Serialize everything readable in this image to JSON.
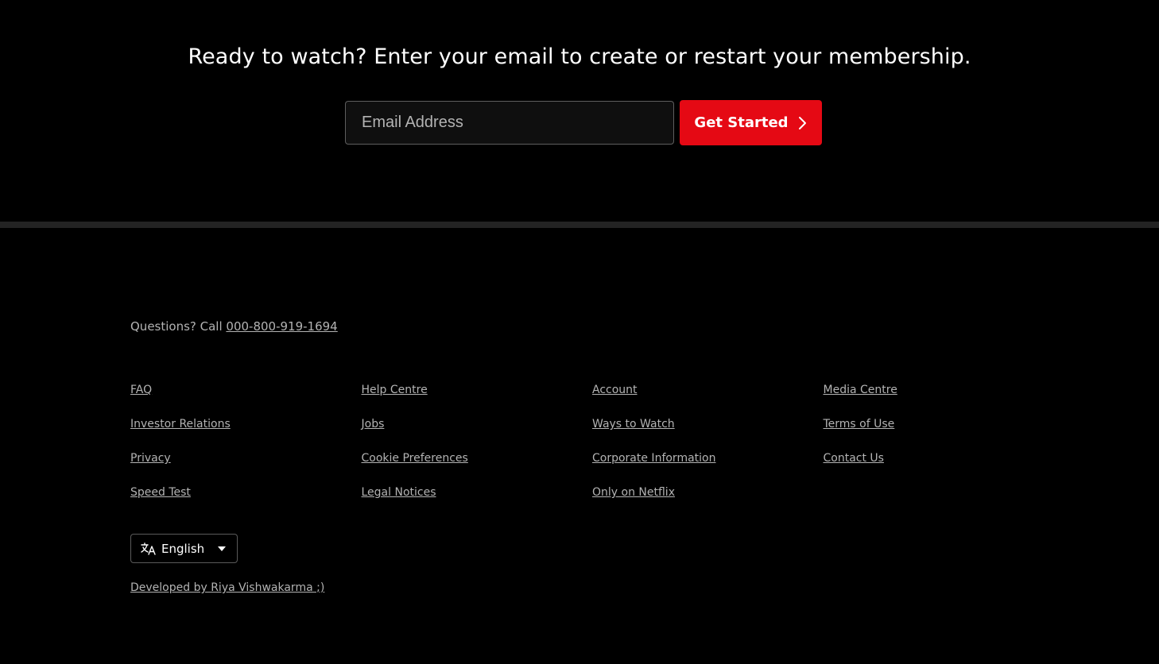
{
  "cta": {
    "heading": "Ready to watch? Enter your email to create or restart your membership.",
    "email_placeholder": "Email Address",
    "button_label": "Get Started"
  },
  "footer": {
    "questions_prefix": "Questions? Call ",
    "phone": "000-800-919-1694",
    "links": [
      "FAQ",
      "Help Centre",
      "Account",
      "Media Centre",
      "Investor Relations",
      "Jobs",
      "Ways to Watch",
      "Terms of Use",
      "Privacy",
      "Cookie Preferences",
      "Corporate Information",
      "Contact Us",
      "Speed Test",
      "Legal Notices",
      "Only on Netflix"
    ],
    "language": "English",
    "credit": "Developed by Riya Vishwakarma ;)"
  },
  "colors": {
    "background": "#000000",
    "accent": "#e50914",
    "muted_text": "#b3b3b3",
    "divider": "#232323"
  },
  "icons": [
    "chevron-right-icon",
    "translate-icon",
    "caret-down-icon"
  ]
}
